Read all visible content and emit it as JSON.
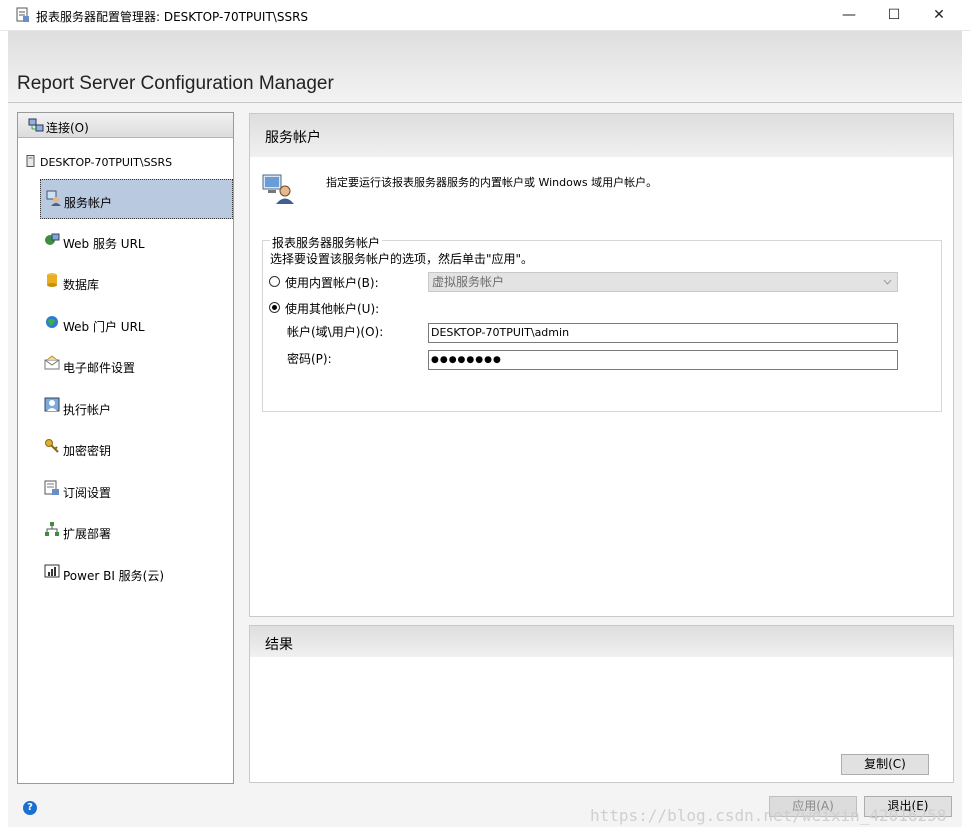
{
  "window": {
    "title": "报表服务器配置管理器: DESKTOP-70TPUIT\\SSRS",
    "minimize": "—",
    "maximize": "☐",
    "close": "✕"
  },
  "header": {
    "title": "Report Server Configuration Manager"
  },
  "nav": {
    "connect_label": "连接(O)",
    "server": "DESKTOP-70TPUIT\\SSRS",
    "items": [
      {
        "label": "服务帐户",
        "icon": "service-account-icon"
      },
      {
        "label": "Web 服务 URL",
        "icon": "web-service-icon"
      },
      {
        "label": "数据库",
        "icon": "database-icon"
      },
      {
        "label": "Web 门户 URL",
        "icon": "globe-icon"
      },
      {
        "label": "电子邮件设置",
        "icon": "email-icon"
      },
      {
        "label": "执行帐户",
        "icon": "execution-account-icon"
      },
      {
        "label": "加密密钥",
        "icon": "key-icon"
      },
      {
        "label": "订阅设置",
        "icon": "subscription-icon"
      },
      {
        "label": "扩展部署",
        "icon": "scale-out-icon"
      },
      {
        "label": "Power BI 服务(云)",
        "icon": "power-bi-icon"
      }
    ],
    "selected_index": 0
  },
  "main": {
    "title": "服务帐户",
    "description": "指定要运行该报表服务器服务的内置帐户或 Windows 域用户帐户。",
    "group_title": "报表服务器服务帐户",
    "instruction": "选择要设置该服务帐户的选项，然后单击\"应用\"。",
    "builtin_label": "使用内置帐户(B):",
    "builtin_value": "虚拟服务帐户",
    "other_label": "使用其他帐户(U):",
    "account_label": "帐户(域\\用户)(O):",
    "account_value": "DESKTOP-70TPUIT\\admin",
    "password_label": "密码(P):",
    "password_value": "●●●●●●●●"
  },
  "results": {
    "title": "结果",
    "copy_label": "复制(C)"
  },
  "footer": {
    "apply_label": "应用(A)",
    "exit_label": "退出(E)",
    "help_glyph": "?",
    "watermark": "https://blog.csdn.net/weixin_42016258"
  }
}
